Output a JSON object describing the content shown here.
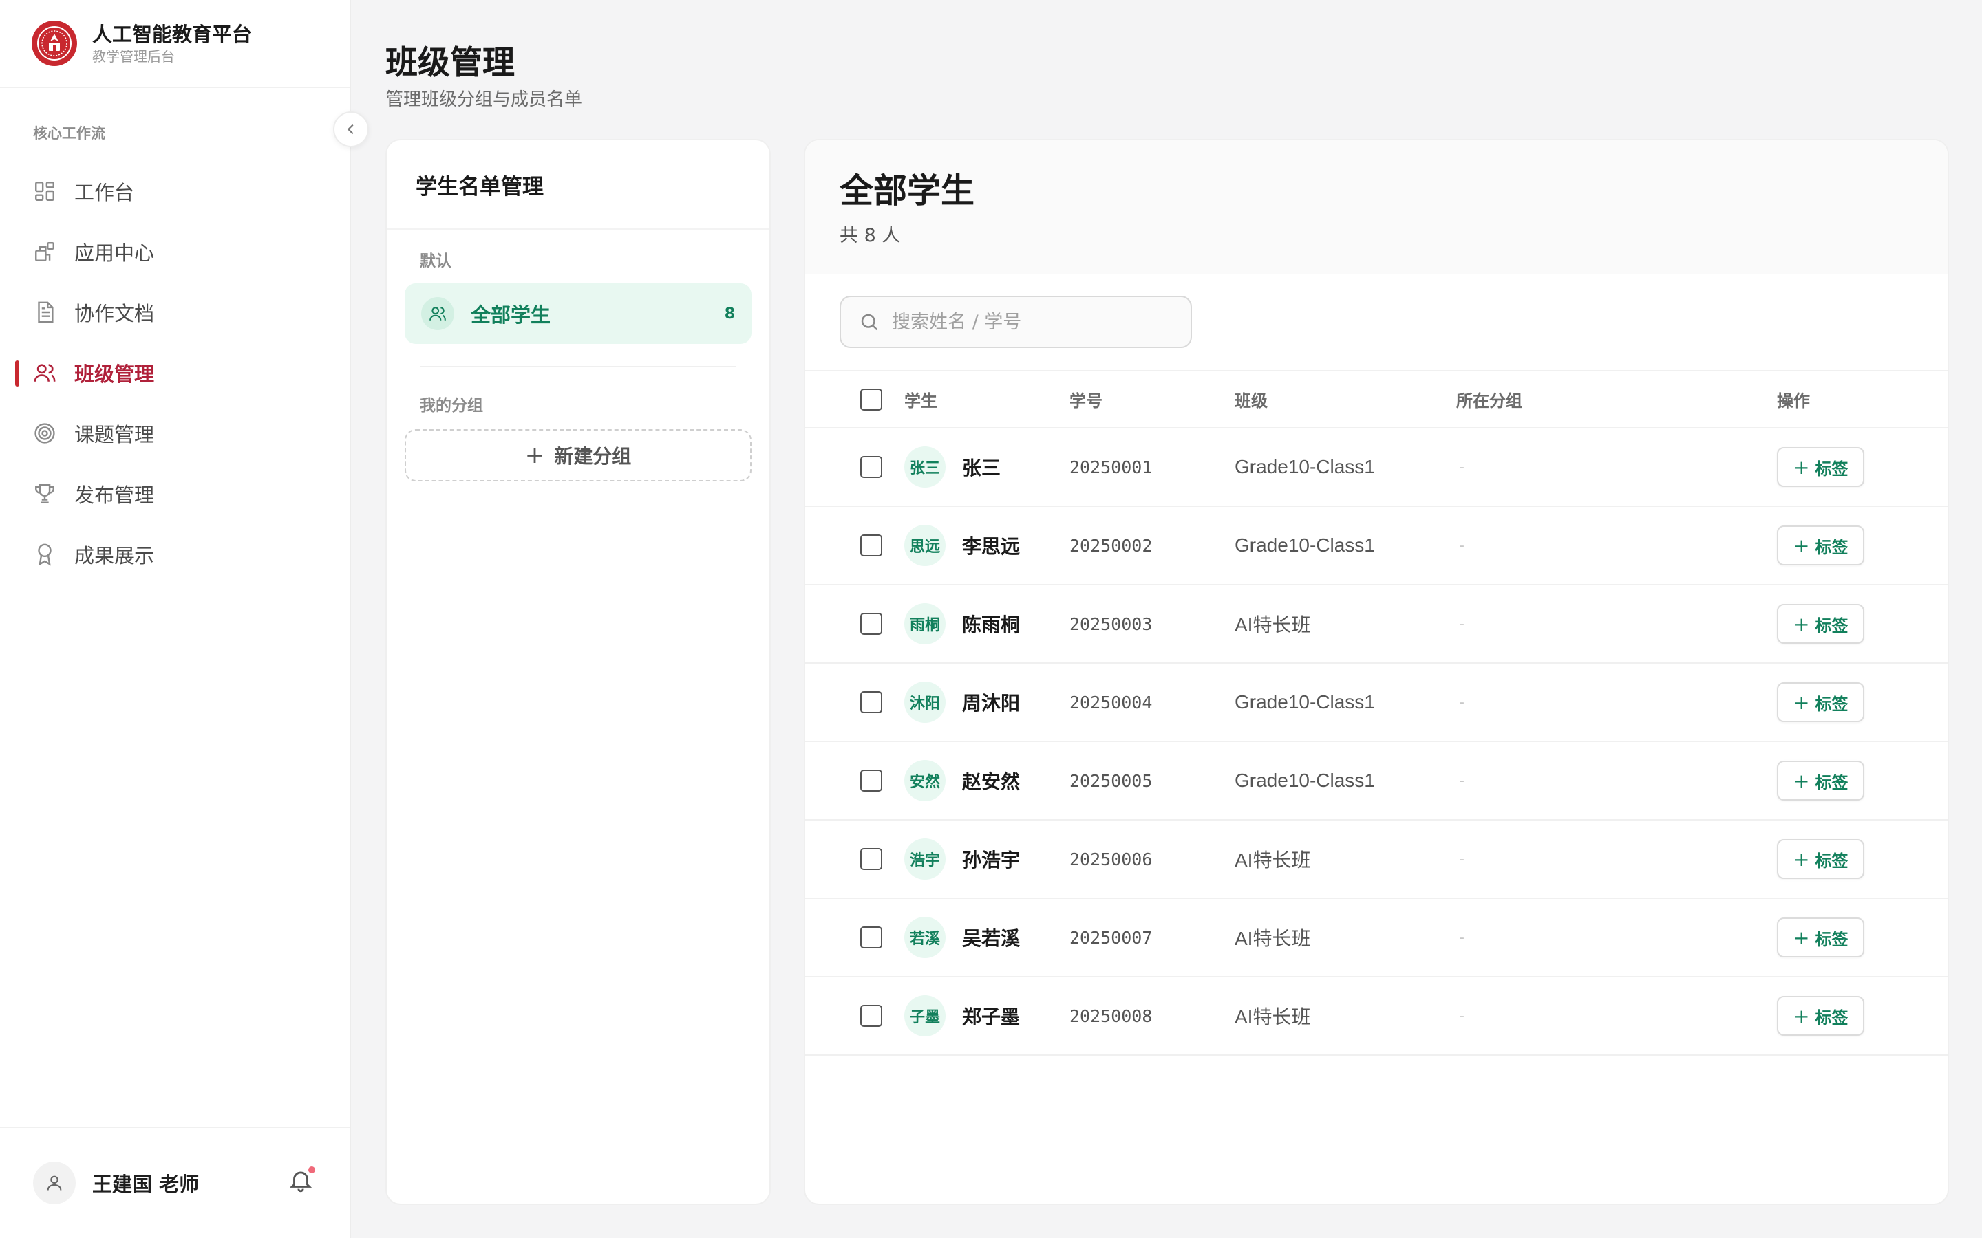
{
  "brand": {
    "title": "人工智能教育平台",
    "subtitle": "教学管理后台"
  },
  "sidebar": {
    "section_label": "核心工作流",
    "items": [
      {
        "label": "工作台",
        "icon": "dashboard-icon"
      },
      {
        "label": "应用中心",
        "icon": "apps-icon"
      },
      {
        "label": "协作文档",
        "icon": "document-icon"
      },
      {
        "label": "班级管理",
        "icon": "users-icon",
        "active": true
      },
      {
        "label": "课题管理",
        "icon": "target-icon"
      },
      {
        "label": "发布管理",
        "icon": "trophy-icon"
      },
      {
        "label": "成果展示",
        "icon": "award-icon"
      }
    ],
    "user_name": "王建国 老师"
  },
  "header": {
    "title": "班级管理",
    "subtitle": "管理班级分组与成员名单"
  },
  "roster_panel": {
    "title": "学生名单管理",
    "default_label": "默认",
    "all_students_label": "全部学生",
    "all_students_count": "8",
    "my_groups_label": "我的分组",
    "new_group_label": "新建分组",
    "plus": "+"
  },
  "main": {
    "title": "全部学生",
    "count_text": "共 8 人",
    "search_placeholder": "搜索姓名 / 学号",
    "columns": {
      "student": "学生",
      "id": "学号",
      "class": "班级",
      "group": "所在分组",
      "action": "操作"
    },
    "tag_label": "标签",
    "rows": [
      {
        "avatar": "张三",
        "name": "张三",
        "id": "20250001",
        "class": "Grade10-Class1",
        "group": "-"
      },
      {
        "avatar": "思远",
        "name": "李思远",
        "id": "20250002",
        "class": "Grade10-Class1",
        "group": "-"
      },
      {
        "avatar": "雨桐",
        "name": "陈雨桐",
        "id": "20250003",
        "class": "AI特长班",
        "group": "-"
      },
      {
        "avatar": "沐阳",
        "name": "周沐阳",
        "id": "20250004",
        "class": "Grade10-Class1",
        "group": "-"
      },
      {
        "avatar": "安然",
        "name": "赵安然",
        "id": "20250005",
        "class": "Grade10-Class1",
        "group": "-"
      },
      {
        "avatar": "浩宇",
        "name": "孙浩宇",
        "id": "20250006",
        "class": "AI特长班",
        "group": "-"
      },
      {
        "avatar": "若溪",
        "name": "吴若溪",
        "id": "20250007",
        "class": "AI特长班",
        "group": "-"
      },
      {
        "avatar": "子墨",
        "name": "郑子墨",
        "id": "20250008",
        "class": "AI特长班",
        "group": "-"
      }
    ]
  },
  "colors": {
    "brand_red": "#c8282f",
    "active_red": "#b0213a",
    "accent_green": "#12805c",
    "green_bg": "#e8f8f1"
  }
}
